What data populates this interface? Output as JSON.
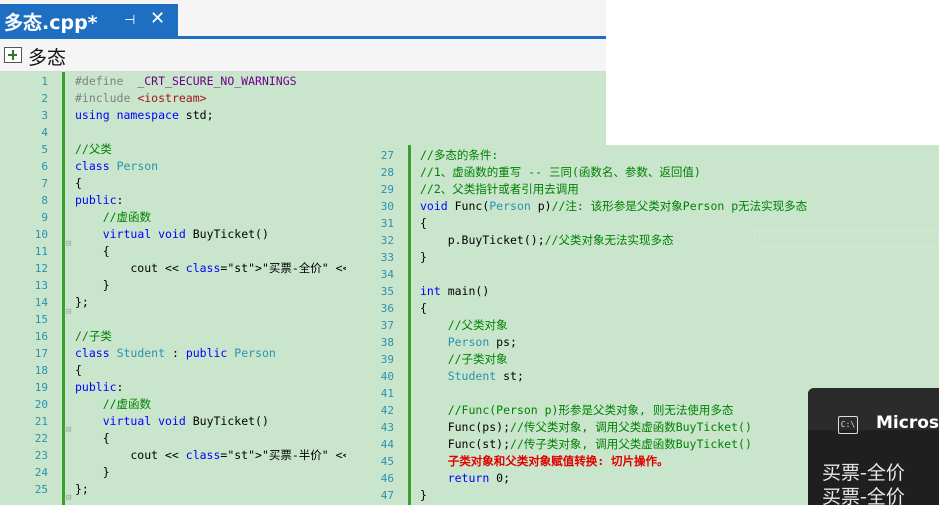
{
  "tab": {
    "title": "多态.cpp*",
    "pin_icon": "pin-icon",
    "close_icon": "close-icon",
    "active_color": "#1e6fc2"
  },
  "nav": {
    "scope": "多态",
    "icon": "class-scope-icon"
  },
  "editor_left": {
    "line_numbers": [
      "1",
      "2",
      "3",
      "4",
      "5",
      "6",
      "7",
      "8",
      "9",
      "10",
      "11",
      "12",
      "13",
      "14",
      "15",
      "16",
      "17",
      "18",
      "19",
      "20",
      "21",
      "22",
      "23",
      "24",
      "25"
    ],
    "lines": [
      "#define  _CRT_SECURE_NO_WARNINGS",
      "#include <iostream>",
      "using namespace std;",
      "",
      "//父类",
      "class Person",
      "{",
      "public:",
      "    //虚函数",
      "    virtual void BuyTicket()",
      "    {",
      "        cout << \"买票-全价\" << endl;",
      "    }",
      "};",
      "",
      "//子类",
      "class Student : public Person",
      "{",
      "public:",
      "    //虚函数",
      "    virtual void BuyTicket()",
      "    {",
      "        cout << \"买票-半价\" << endl;",
      "    }",
      "};"
    ]
  },
  "editor_right": {
    "line_numbers": [
      "27",
      "28",
      "29",
      "30",
      "31",
      "32",
      "33",
      "34",
      "35",
      "36",
      "37",
      "38",
      "39",
      "40",
      "41",
      "42",
      "43",
      "44",
      "45",
      "46",
      "47"
    ],
    "lines": [
      "//多态的条件:",
      "//1、虚函数的重写 -- 三同(函数名、参数、返回值)",
      "//2、父类指针或者引用去调用",
      "void Func(Person p)//注: 该形参是父类对象Person p无法实现多态",
      "{",
      "    p.BuyTicket();//父类对象无法实现多态",
      "}",
      "",
      "int main()",
      "{",
      "    //父类对象",
      "    Person ps;",
      "    //子类对象",
      "    Student st;",
      "",
      "    //Func(Person p)形参是父类对象, 则无法使用多态",
      "    Func(ps);//传父类对象, 调用父类虚函数BuyTicket()",
      "    Func(st);//传子类对象, 调用父类虚函数BuyTicket()",
      "    子类对象和父类对象赋值转换: 切片操作。",
      "    return 0;",
      "}"
    ]
  },
  "console": {
    "icon": "console-icon",
    "icon_text": "C:\\",
    "title": "Microso",
    "output": [
      "买票-全价",
      "买票-全价"
    ]
  },
  "colors": {
    "editor_bg": "#c9e6cd",
    "change_bar": "#3aa02b",
    "keyword": "#0000ff",
    "type": "#2b91af",
    "comment": "#008000",
    "annotation": "#e00000"
  }
}
